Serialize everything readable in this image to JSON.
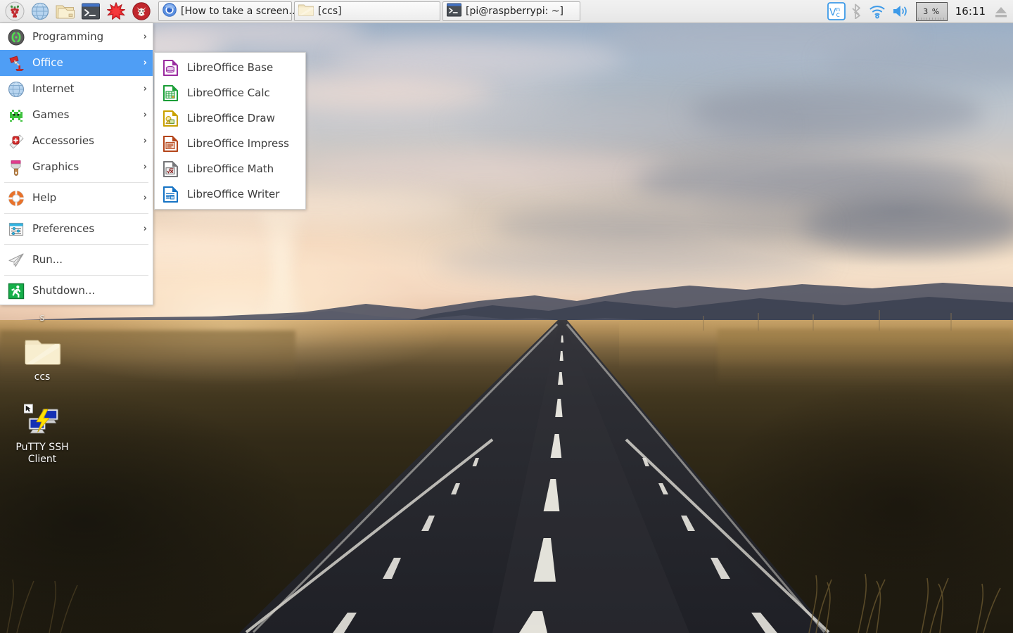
{
  "taskbar": {
    "launchers": [
      {
        "name": "raspberry-menu-icon",
        "label": "Menu"
      },
      {
        "name": "web-browser-icon",
        "label": "Web Browser"
      },
      {
        "name": "file-manager-icon",
        "label": "File Manager"
      },
      {
        "name": "terminal-icon",
        "label": "Terminal"
      },
      {
        "name": "mathematica-icon",
        "label": "Mathematica"
      },
      {
        "name": "wolfram-icon",
        "label": "Wolfram"
      }
    ],
    "tasks": [
      {
        "icon": "chromium-icon",
        "label": "[How to take a screen…]"
      },
      {
        "icon": "folder-icon",
        "label": "[ccs]"
      },
      {
        "icon": "terminal-icon",
        "label": "[pi@raspberrypi: ~]"
      }
    ],
    "tray": {
      "vnc_label": "VNC",
      "bluetooth_label": "Bluetooth",
      "wifi_label": "Wireless",
      "volume_label": "Volume",
      "cpu_label": "3 %",
      "clock": "16:11",
      "eject_label": "Eject"
    }
  },
  "menu": {
    "items": [
      {
        "label": "Programming",
        "icon": "programming-icon",
        "arrow": "›",
        "selected": false
      },
      {
        "label": "Office",
        "icon": "office-lamp-icon",
        "arrow": "›",
        "selected": true
      },
      {
        "label": "Internet",
        "icon": "globe-icon",
        "arrow": "›",
        "selected": false
      },
      {
        "label": "Games",
        "icon": "games-invader-icon",
        "arrow": "›",
        "selected": false
      },
      {
        "label": "Accessories",
        "icon": "accessories-knife-icon",
        "arrow": "›",
        "selected": false
      },
      {
        "label": "Graphics",
        "icon": "graphics-brush-icon",
        "arrow": "›",
        "selected": false
      },
      {
        "label": "Help",
        "icon": "help-lifering-icon",
        "arrow": "›",
        "selected": false
      },
      {
        "label": "Preferences",
        "icon": "preferences-icon",
        "arrow": "›",
        "selected": false
      },
      {
        "label": "Run...",
        "icon": "run-plane-icon",
        "arrow": "",
        "selected": false
      },
      {
        "label": "Shutdown...",
        "icon": "shutdown-exit-icon",
        "arrow": "",
        "selected": false
      }
    ]
  },
  "submenu": {
    "parent": "Office",
    "items": [
      {
        "label": "LibreOffice Base",
        "icon": "libreoffice-base-icon",
        "color": "#9a2ca0"
      },
      {
        "label": "LibreOffice Calc",
        "icon": "libreoffice-calc-icon",
        "color": "#1c9e38"
      },
      {
        "label": "LibreOffice Draw",
        "icon": "libreoffice-draw-icon",
        "color": "#c9a100"
      },
      {
        "label": "LibreOffice Impress",
        "icon": "libreoffice-impress-icon",
        "color": "#b4451a"
      },
      {
        "label": "LibreOffice Math",
        "icon": "libreoffice-math-icon",
        "color": "#76777a"
      },
      {
        "label": "LibreOffice Writer",
        "icon": "libreoffice-writer-icon",
        "color": "#1673c4"
      }
    ]
  },
  "desktop": {
    "icons": [
      {
        "label": "ccs",
        "icon": "folder-icon"
      },
      {
        "label": "PuTTY SSH Client",
        "icon": "putty-icon"
      }
    ],
    "stray_text": "s"
  },
  "colors": {
    "accent_highlight": "#4f9ef5",
    "taskbar_bg": "#ececec",
    "menu_bg": "#ffffff",
    "menu_text": "#3c3c3c",
    "vnc_blue": "#3d9ae8"
  }
}
